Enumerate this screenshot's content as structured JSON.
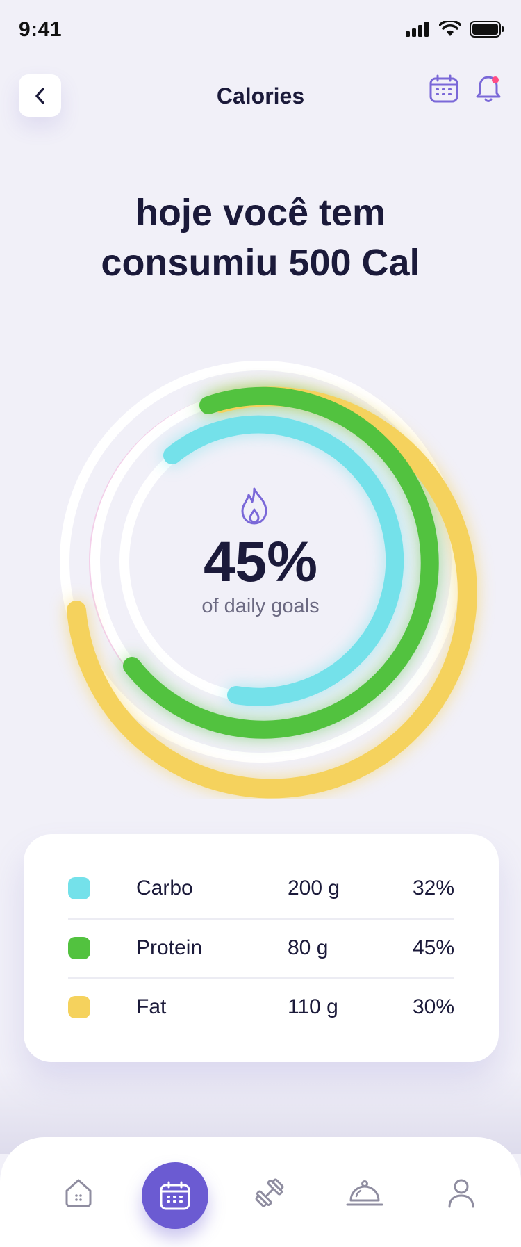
{
  "status_bar": {
    "time": "9:41"
  },
  "header": {
    "title": "Calories"
  },
  "headline": {
    "line1": "hoje você tem",
    "line2": "consumiu 500 Cal"
  },
  "progress": {
    "percent_label": "45%",
    "subtitle": "of daily goals"
  },
  "macros": [
    {
      "name": "Carbo",
      "amount": "200 g",
      "percent": "32%",
      "color": "#74e1ea"
    },
    {
      "name": "Protein",
      "amount": "80 g",
      "percent": "45%",
      "color": "#52c23f"
    },
    {
      "name": "Fat",
      "amount": "110 g",
      "percent": "30%",
      "color": "#f5d25d"
    }
  ],
  "colors": {
    "accent": "#6b5bd2",
    "background": "#f1f0f8",
    "text": "#1b1a3a"
  },
  "tab_bar": [
    "home-icon",
    "calendar-icon",
    "dumbbell-icon",
    "food-cloche-icon",
    "profile-icon"
  ]
}
